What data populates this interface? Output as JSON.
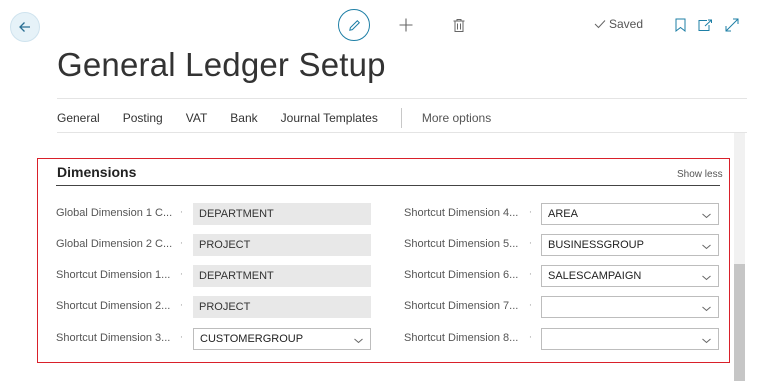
{
  "topbar": {
    "back_icon": "arrow-left-icon",
    "edit_icon": "pencil-icon",
    "new_icon": "plus-icon",
    "delete_icon": "trash-icon",
    "saved_label": "Saved",
    "bookmark_icon": "bookmark-icon",
    "open_new_icon": "open-in-new-window-icon",
    "expand_icon": "expand-icon"
  },
  "page": {
    "title": "General Ledger Setup"
  },
  "actions": {
    "tabs": [
      "General",
      "Posting",
      "VAT",
      "Bank",
      "Journal Templates"
    ],
    "more": "More options"
  },
  "section": {
    "title": "Dimensions",
    "toggle": "Show less",
    "left": [
      {
        "label": "Global Dimension 1 C...",
        "value": "DEPARTMENT",
        "editable": false
      },
      {
        "label": "Global Dimension 2 C...",
        "value": "PROJECT",
        "editable": false
      },
      {
        "label": "Shortcut Dimension 1...",
        "value": "DEPARTMENT",
        "editable": false
      },
      {
        "label": "Shortcut Dimension 2...",
        "value": "PROJECT",
        "editable": false
      },
      {
        "label": "Shortcut Dimension 3...",
        "value": "CUSTOMERGROUP",
        "editable": true
      }
    ],
    "right": [
      {
        "label": "Shortcut Dimension 4...",
        "value": "AREA",
        "editable": true
      },
      {
        "label": "Shortcut Dimension 5...",
        "value": "BUSINESSGROUP",
        "editable": true
      },
      {
        "label": "Shortcut Dimension 6...",
        "value": "SALESCAMPAIGN",
        "editable": true
      },
      {
        "label": "Shortcut Dimension 7...",
        "value": "",
        "editable": true
      },
      {
        "label": "Shortcut Dimension 8...",
        "value": "",
        "editable": true
      }
    ]
  },
  "colors": {
    "accent": "#1e7fa6",
    "highlight": "#d9202a"
  }
}
